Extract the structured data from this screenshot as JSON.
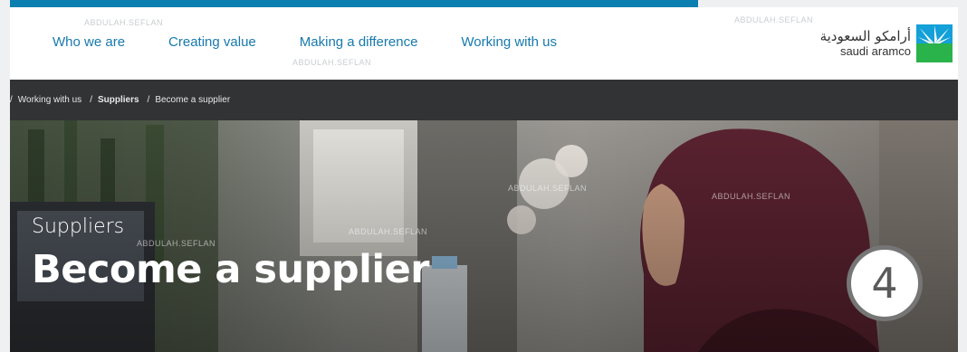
{
  "nav": {
    "items": [
      {
        "label": "Who we are"
      },
      {
        "label": "Creating value"
      },
      {
        "label": "Making a difference"
      },
      {
        "label": "Working with us"
      }
    ]
  },
  "logo": {
    "arabic": "أرامكو السعودية",
    "english": "saudi aramco"
  },
  "breadcrumb": {
    "lead_sep": "/",
    "items": [
      {
        "label": "Working with us"
      },
      {
        "label": "Suppliers"
      },
      {
        "label": "Become a supplier"
      }
    ],
    "sep": "/"
  },
  "hero": {
    "subtitle": "Suppliers",
    "title": "Become a supplier"
  },
  "watermark": "ABDULAH.SEFLAN",
  "step_badge": "4",
  "colors": {
    "accent": "#0a7fb0",
    "nav_link": "#1779ad",
    "breadcrumb_bar": "#313335",
    "hijab": "#5a2230"
  }
}
